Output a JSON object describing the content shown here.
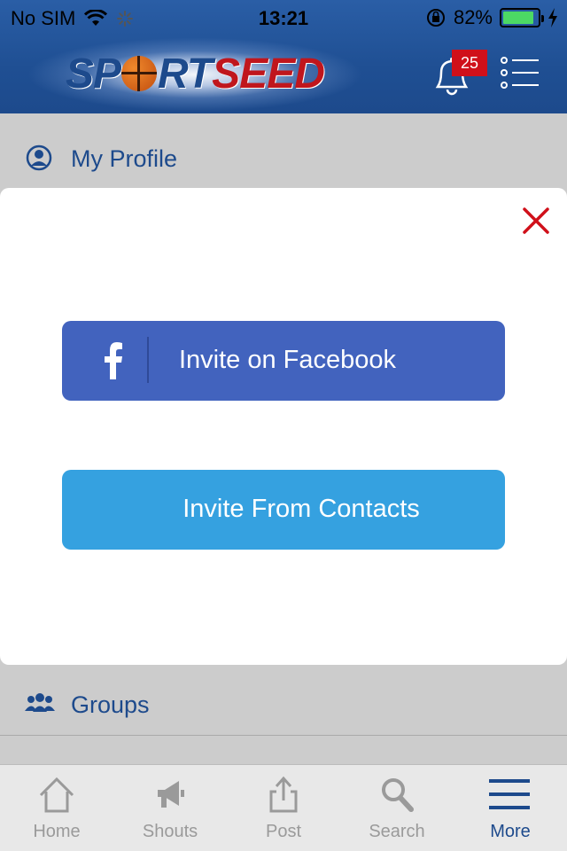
{
  "status_bar": {
    "carrier": "No SIM",
    "time": "13:21",
    "battery_percent": "82%",
    "battery_level": 0.82
  },
  "header": {
    "logo_text_part1": "SP",
    "logo_text_part2": "RT",
    "logo_text_part3": "SEED",
    "notification_count": "25",
    "colors": {
      "header_bg": "#1f4f93",
      "badge_bg": "#d0101a"
    }
  },
  "menu": {
    "my_profile_label": "My Profile",
    "groups_label": "Groups"
  },
  "modal": {
    "facebook_button_label": "Invite on Facebook",
    "contacts_button_label": "Invite From Contacts",
    "colors": {
      "facebook": "#4263be",
      "contacts": "#35a1e0",
      "close": "#d0101a"
    }
  },
  "tab_bar": {
    "tabs": [
      {
        "label": "Home",
        "icon": "home-icon",
        "active": false
      },
      {
        "label": "Shouts",
        "icon": "megaphone-icon",
        "active": false
      },
      {
        "label": "Post",
        "icon": "share-icon",
        "active": false
      },
      {
        "label": "Search",
        "icon": "search-icon",
        "active": false
      },
      {
        "label": "More",
        "icon": "hamburger-icon",
        "active": true
      }
    ]
  }
}
